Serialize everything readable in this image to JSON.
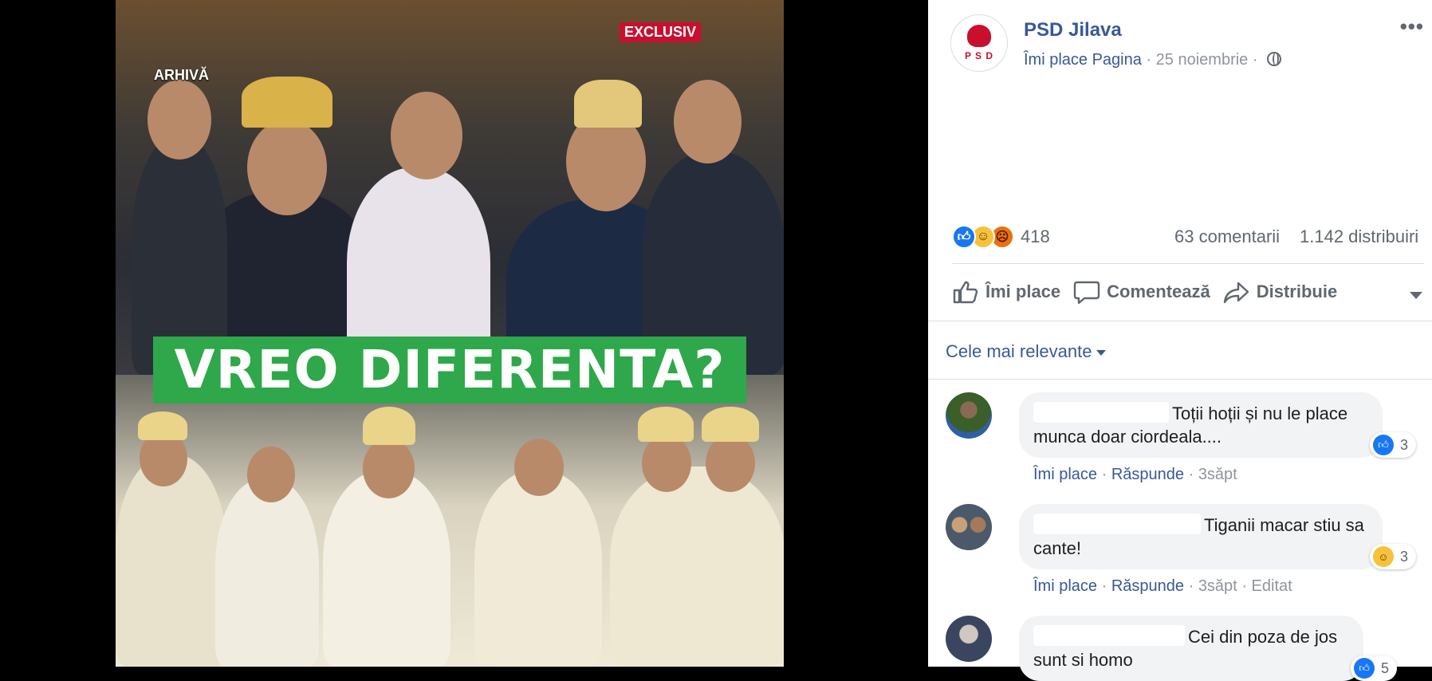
{
  "photo": {
    "tag_archive": "ARHIVĂ",
    "tag_exclusive": "EXCLUSIV",
    "banner_text": "VREO DIFERENTA?"
  },
  "post": {
    "page_name": "PSD Jilava",
    "avatar_logo": "P S D",
    "like_page": "Îmi place Pagina",
    "separator": "·",
    "date": "25 noiembrie",
    "more": "•••",
    "reactions_count": "418",
    "comments_count": "63 comentarii",
    "shares_count": "1.142 distribuiri",
    "actions": {
      "like": "Îmi place",
      "comment": "Comentează",
      "share": "Distribuie"
    },
    "sort_label": "Cele mai relevante"
  },
  "comments": [
    {
      "text": "Toții hoții și nu le place munca doar ciordeala....",
      "reaction_count": "3",
      "reaction": "like-icon",
      "like": "Îmi place",
      "reply": "Răspunde",
      "time": "3săpt",
      "edited": ""
    },
    {
      "text": "Tiganii macar stiu sa cante!",
      "reaction_count": "3",
      "reaction": "haha-icon",
      "like": "Îmi place",
      "reply": "Răspunde",
      "time": "3săpt",
      "edited": "Editat"
    },
    {
      "text": "Cei din poza de jos sunt si homo",
      "reaction_count": "5",
      "reaction": "like-icon"
    }
  ],
  "colors": {
    "link": "#385898",
    "banner": "#2ea84a",
    "brand_red": "#c8102e"
  }
}
